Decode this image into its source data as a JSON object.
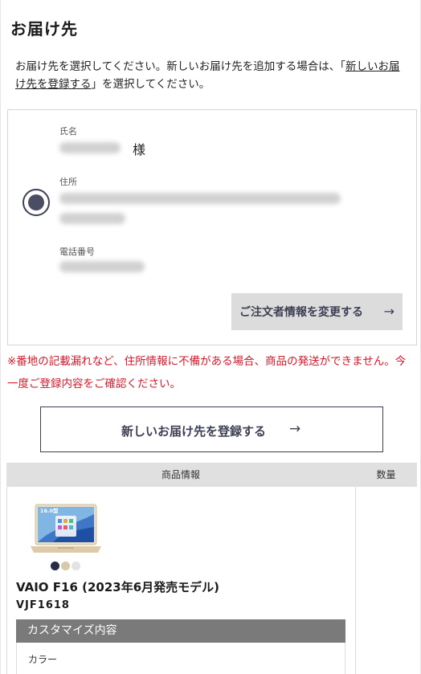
{
  "page": {
    "title": "お届け先",
    "intro_before": "お届け先を選択してください。新しいお届け先を追加する場合は、「",
    "intro_link": "新しいお届け先を登録する",
    "intro_after": "」を選択してください。"
  },
  "address_card": {
    "name_label": "氏名",
    "honorific": "様",
    "address_label": "住所",
    "phone_label": "電話番号",
    "change_button": "ご注文者情報を変更する",
    "change_arrow": "→"
  },
  "warning": "※番地の記載漏れなど、住所情報に不備がある場合、商品の発送ができません。今一度ご登録内容をご確認ください。",
  "new_address_button": {
    "label": "新しいお届け先を登録する",
    "arrow": "→"
  },
  "table": {
    "header_product": "商品情報",
    "header_quantity": "数量"
  },
  "product": {
    "screen_badge": "16.0型",
    "name": "VAIO F16 (2023年6月発売モデル)",
    "code": "VJF1618",
    "swatches": [
      "#262b46",
      "#d9c9ab",
      "#e3e3e3"
    ],
    "customize_header": "カスタマイズ内容",
    "color_label": "カラー"
  }
}
